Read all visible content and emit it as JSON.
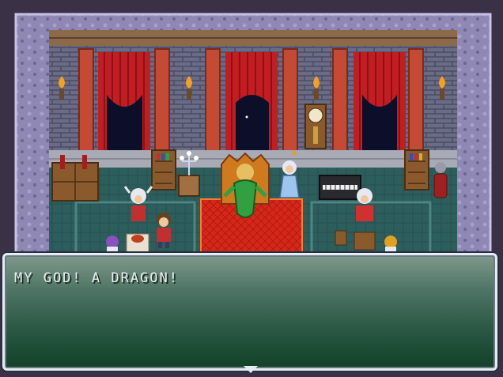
{
  "scene": {
    "location": "throne-room",
    "characters": [
      "dragon-on-throne",
      "white-haired-queen",
      "hero-boy",
      "horned-helmet-warrior",
      "red-armored-warrior",
      "purple-haired-child",
      "orange-haired-child"
    ],
    "icons": [
      "torch-icon",
      "curtained-window-icon",
      "grandfather-clock-icon",
      "bookshelf-icon",
      "piano-icon",
      "candelabra-icon",
      "suit-of-armor-icon"
    ],
    "colors": {
      "wall_stone": "#6a6c86",
      "frame_stone": "#8f88b4",
      "curtain": "#c01e22",
      "pillar": "#c44a34",
      "floor_teal": "#2c5e5c",
      "carpet": "#d52818",
      "dialog_top": "#7f9a8c",
      "dialog_bottom": "#114128"
    }
  },
  "dialog": {
    "text": "MY GOD! A DRAGON!",
    "indicator_icon": "advance-arrow-icon"
  }
}
